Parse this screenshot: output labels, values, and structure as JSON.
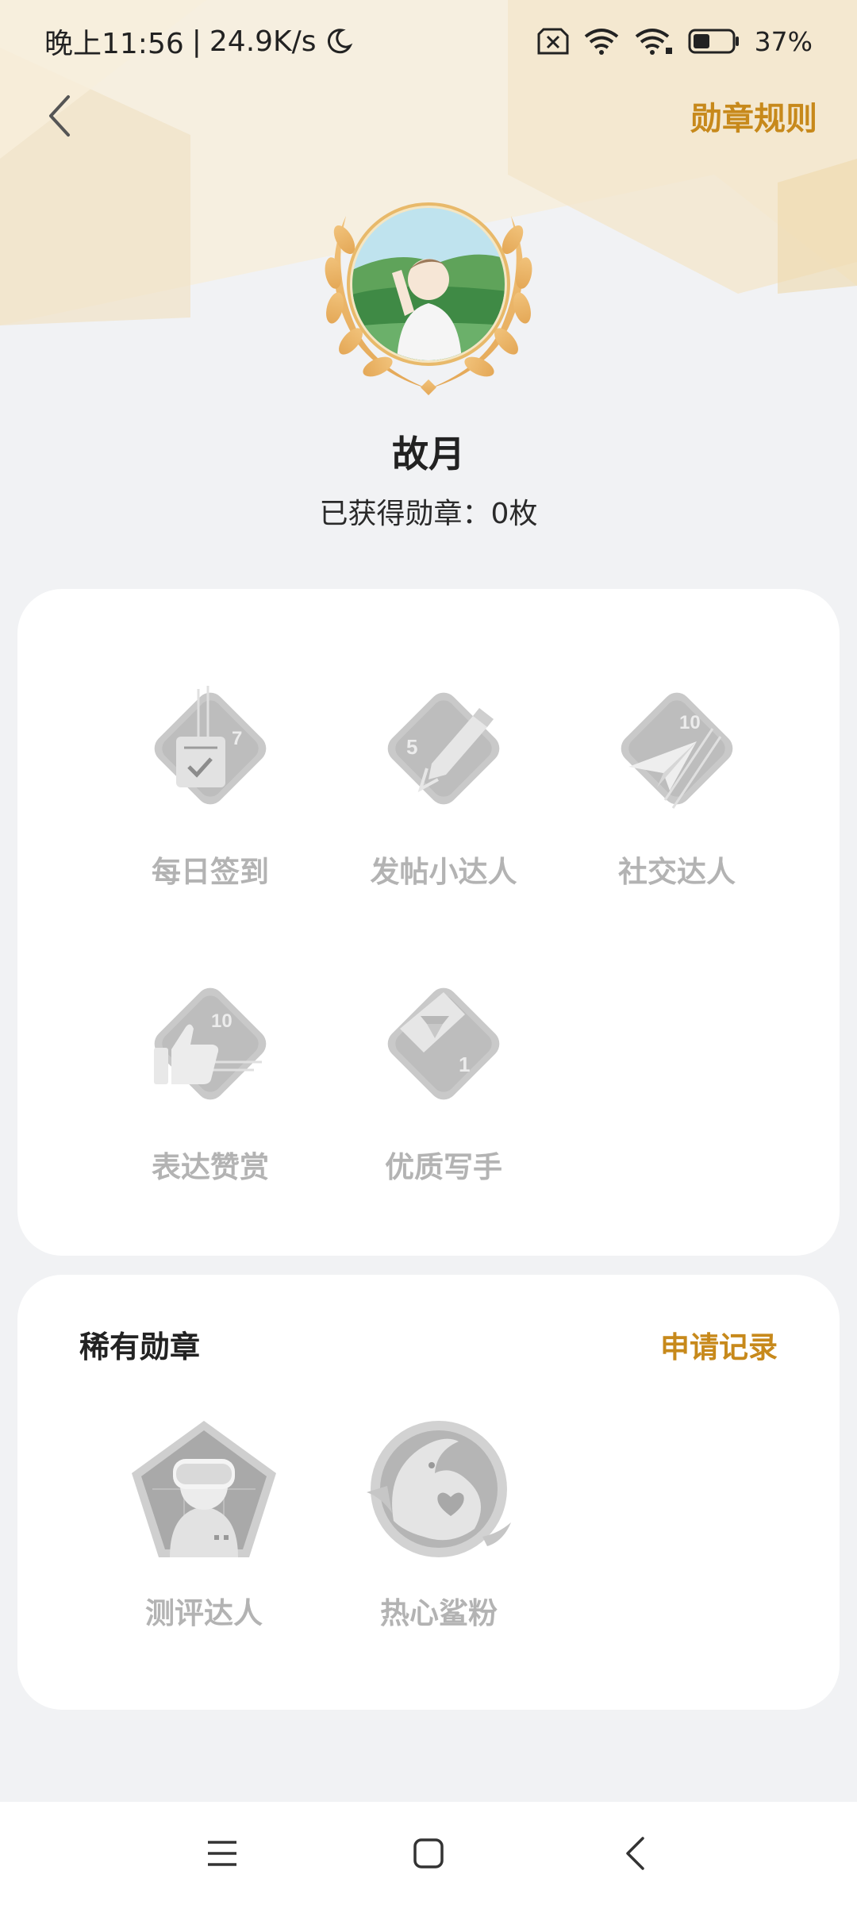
{
  "status": {
    "time": "晚上11:56",
    "speed": "24.9K/s",
    "battery": "37%"
  },
  "nav": {
    "back_icon": "chevron-left-icon",
    "rules": "勋章规则"
  },
  "profile": {
    "name": "故月",
    "badge_count": "已获得勋章：0枚"
  },
  "badges": [
    {
      "label": "每日签到",
      "icon": "checkin-calendar-icon",
      "number": "7"
    },
    {
      "label": "发帖小达人",
      "icon": "post-pen-icon",
      "number": "5"
    },
    {
      "label": "社交达人",
      "icon": "paper-plane-icon",
      "number": "10"
    },
    {
      "label": "表达赞赏",
      "icon": "thumbs-up-icon",
      "number": "10"
    },
    {
      "label": "优质写手",
      "icon": "diamond-icon",
      "number": "1"
    }
  ],
  "rare": {
    "title": "稀有勋章",
    "apply_record": "申请记录",
    "badges": [
      {
        "label": "测评达人",
        "icon": "vr-headset-reviewer-icon"
      },
      {
        "label": "热心鲨粉",
        "icon": "shark-heart-icon"
      }
    ]
  },
  "colors": {
    "accent": "#c7891b",
    "background": "#f1f2f4",
    "badge_gray": "#b3b3b3"
  }
}
